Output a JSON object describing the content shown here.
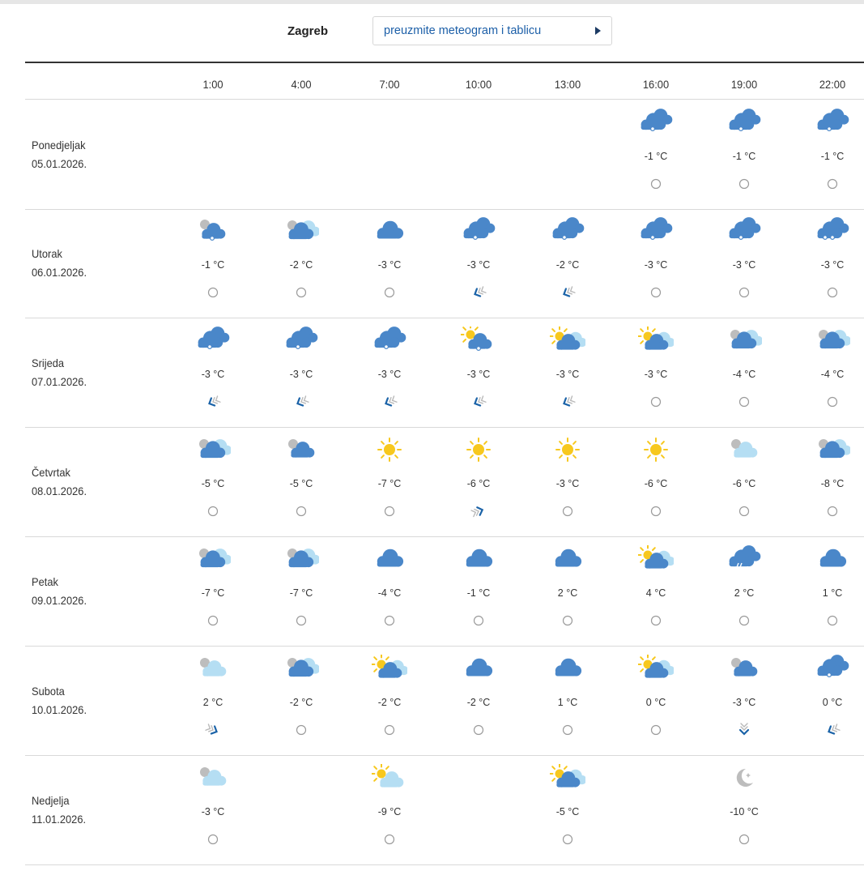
{
  "header": {
    "city": "Zagreb",
    "download_label": "preuzmite meteogram i tablicu"
  },
  "hours": [
    "1:00",
    "4:00",
    "7:00",
    "10:00",
    "13:00",
    "16:00",
    "19:00",
    "22:00"
  ],
  "colors": {
    "cloud_dark": "#4a87c9",
    "cloud_light": "#b5def3",
    "sun": "#f7c81e",
    "moon": "#bdbdbd",
    "wind_arrow": "#1b63a8",
    "link": "#1c5fa8"
  },
  "days": [
    {
      "name": "Ponedjeljak",
      "date": "05.01.2026.",
      "cells": [
        null,
        null,
        null,
        null,
        null,
        {
          "icon": "snow-cloud-icon",
          "temp": "-1 °C",
          "wind": "calm-icon"
        },
        {
          "icon": "snow-cloud-icon",
          "temp": "-1 °C",
          "wind": "calm-icon"
        },
        {
          "icon": "snow-cloud-icon",
          "temp": "-1 °C",
          "wind": "calm-icon"
        }
      ]
    },
    {
      "name": "Utorak",
      "date": "06.01.2026.",
      "cells": [
        {
          "icon": "night-snow-cloud-icon",
          "temp": "-1 °C",
          "wind": "calm-icon"
        },
        {
          "icon": "night-partly-cloudy-icon",
          "temp": "-2 °C",
          "wind": "calm-icon"
        },
        {
          "icon": "cloud-icon",
          "temp": "-3 °C",
          "wind": "calm-icon"
        },
        {
          "icon": "snow-cloud-icon",
          "temp": "-3 °C",
          "wind": "wind-sw-icon"
        },
        {
          "icon": "snow-cloud-icon",
          "temp": "-2 °C",
          "wind": "wind-sw-icon"
        },
        {
          "icon": "snow-cloud-icon",
          "temp": "-3 °C",
          "wind": "calm-icon"
        },
        {
          "icon": "snow-cloud-icon",
          "temp": "-3 °C",
          "wind": "calm-icon"
        },
        {
          "icon": "heavy-snow-cloud-icon",
          "temp": "-3 °C",
          "wind": "calm-icon"
        }
      ]
    },
    {
      "name": "Srijeda",
      "date": "07.01.2026.",
      "cells": [
        {
          "icon": "snow-cloud-icon",
          "temp": "-3 °C",
          "wind": "wind-sw-icon"
        },
        {
          "icon": "snow-cloud-icon",
          "temp": "-3 °C",
          "wind": "wind-sw-icon"
        },
        {
          "icon": "snow-cloud-icon",
          "temp": "-3 °C",
          "wind": "wind-sw-icon"
        },
        {
          "icon": "sun-snow-cloud-icon",
          "temp": "-3 °C",
          "wind": "wind-sw-icon"
        },
        {
          "icon": "sun-partly-cloudy-icon",
          "temp": "-3 °C",
          "wind": "wind-sw-icon"
        },
        {
          "icon": "sun-partly-cloudy-icon",
          "temp": "-3 °C",
          "wind": "calm-icon"
        },
        {
          "icon": "night-partly-cloudy-icon",
          "temp": "-4 °C",
          "wind": "calm-icon"
        },
        {
          "icon": "night-partly-cloudy-icon",
          "temp": "-4 °C",
          "wind": "calm-icon"
        }
      ]
    },
    {
      "name": "Četvrtak",
      "date": "08.01.2026.",
      "cells": [
        {
          "icon": "night-partly-cloudy-icon",
          "temp": "-5 °C",
          "wind": "calm-icon"
        },
        {
          "icon": "night-cloud-icon",
          "temp": "-5 °C",
          "wind": "calm-icon"
        },
        {
          "icon": "sun-icon",
          "temp": "-7 °C",
          "wind": "calm-icon"
        },
        {
          "icon": "sun-icon",
          "temp": "-6 °C",
          "wind": "wind-ne-icon"
        },
        {
          "icon": "sun-icon",
          "temp": "-3 °C",
          "wind": "calm-icon"
        },
        {
          "icon": "sun-icon",
          "temp": "-6 °C",
          "wind": "calm-icon"
        },
        {
          "icon": "night-light-cloud-icon",
          "temp": "-6 °C",
          "wind": "calm-icon"
        },
        {
          "icon": "night-partly-cloudy-icon",
          "temp": "-8 °C",
          "wind": "calm-icon"
        }
      ]
    },
    {
      "name": "Petak",
      "date": "09.01.2026.",
      "cells": [
        {
          "icon": "night-partly-cloudy-icon",
          "temp": "-7 °C",
          "wind": "calm-icon"
        },
        {
          "icon": "night-partly-cloudy-icon",
          "temp": "-7 °C",
          "wind": "calm-icon"
        },
        {
          "icon": "cloud-icon",
          "temp": "-4 °C",
          "wind": "calm-icon"
        },
        {
          "icon": "cloud-icon",
          "temp": "-1 °C",
          "wind": "calm-icon"
        },
        {
          "icon": "cloud-icon",
          "temp": "2 °C",
          "wind": "calm-icon"
        },
        {
          "icon": "sun-partly-cloudy-icon",
          "temp": "4 °C",
          "wind": "calm-icon"
        },
        {
          "icon": "rain-cloud-icon",
          "temp": "2 °C",
          "wind": "calm-icon"
        },
        {
          "icon": "cloud-icon",
          "temp": "1 °C",
          "wind": "calm-icon"
        }
      ]
    },
    {
      "name": "Subota",
      "date": "10.01.2026.",
      "cells": [
        {
          "icon": "night-light-cloud-icon",
          "temp": "2 °C",
          "wind": "wind-se-icon"
        },
        {
          "icon": "night-partly-cloudy-icon",
          "temp": "-2 °C",
          "wind": "calm-icon"
        },
        {
          "icon": "sun-partly-cloudy-icon",
          "temp": "-2 °C",
          "wind": "calm-icon"
        },
        {
          "icon": "cloud-icon",
          "temp": "-2 °C",
          "wind": "calm-icon"
        },
        {
          "icon": "cloud-icon",
          "temp": "1 °C",
          "wind": "calm-icon"
        },
        {
          "icon": "sun-partly-cloudy-icon",
          "temp": "0 °C",
          "wind": "calm-icon"
        },
        {
          "icon": "night-cloud-icon",
          "temp": "-3 °C",
          "wind": "wind-s-icon"
        },
        {
          "icon": "snow-cloud-icon",
          "temp": "0 °C",
          "wind": "wind-sw-icon"
        }
      ]
    },
    {
      "name": "Nedjelja",
      "date": "11.01.2026.",
      "cells": [
        {
          "icon": "night-light-cloud-icon",
          "temp": "-3 °C",
          "wind": "calm-icon"
        },
        null,
        {
          "icon": "sun-light-cloud-icon",
          "temp": "-9 °C",
          "wind": "calm-icon"
        },
        null,
        {
          "icon": "sun-partly-cloudy-icon",
          "temp": "-5 °C",
          "wind": "calm-icon"
        },
        null,
        {
          "icon": "moon-icon",
          "temp": "-10 °C",
          "wind": "calm-icon"
        },
        null
      ]
    }
  ]
}
